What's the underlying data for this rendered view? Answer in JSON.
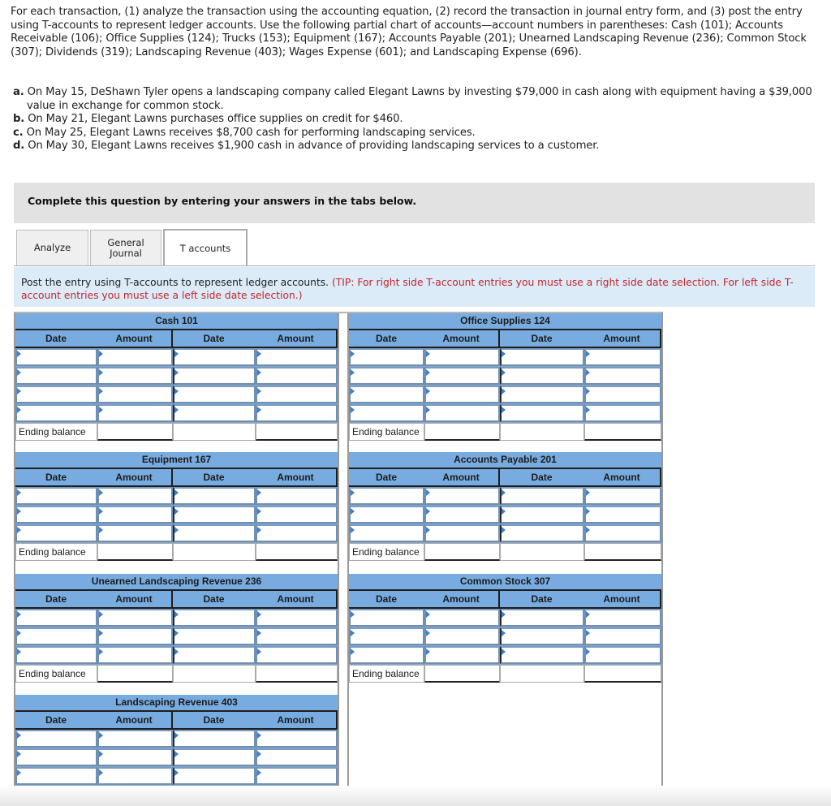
{
  "intro": {
    "text": "For each transaction, (1) analyze the transaction using the accounting equation, (2) record the transaction in journal entry form, and (3) post the entry using T-accounts to represent ledger accounts. Use the following partial chart of accounts—account numbers in parentheses: Cash (101); Accounts Receivable (106); Office Supplies (124); Trucks (153); Equipment (167); Accounts Payable (201); Unearned Landscaping Revenue (236); Common Stock (307); Dividends (319); Landscaping Revenue (403); Wages Expense (601); and Landscaping Expense (696)."
  },
  "transactions": [
    {
      "letter": "a.",
      "text": "On May 15, DeShawn Tyler opens a landscaping company called Elegant Lawns by investing $79,000 in cash along with equipment having a $39,000 value in exchange for common stock."
    },
    {
      "letter": "b.",
      "text": "On May 21, Elegant Lawns purchases office supplies on credit for $460."
    },
    {
      "letter": "c.",
      "text": "On May 25, Elegant Lawns receives $8,700 cash for performing landscaping services."
    },
    {
      "letter": "d.",
      "text": "On May 30, Elegant Lawns receives $1,900 cash in advance of providing landscaping services to a customer."
    }
  ],
  "banner": "Complete this question by entering your answers in the tabs below.",
  "tabs": [
    {
      "label_line1": "Analyze",
      "label_line2": "",
      "active": false
    },
    {
      "label_line1": "General",
      "label_line2": "Journal",
      "active": false
    },
    {
      "label_line1": "T accounts",
      "label_line2": "",
      "active": true
    }
  ],
  "instruction": {
    "text": "Post the entry using T-accounts to represent ledger accounts. ",
    "tip": "(TIP: For right side T-account entries you must use a right side date selection. For left side T-account entries you must use a left side date selection.)"
  },
  "column_headers": {
    "date": "Date",
    "amount": "Amount"
  },
  "ending_balance_label": "Ending balance",
  "accounts": [
    {
      "title": "Cash 101",
      "rows": 4,
      "side": "left"
    },
    {
      "title": "Office Supplies 124",
      "rows": 4,
      "side": "right"
    },
    {
      "title": "Equipment 167",
      "rows": 3,
      "side": "left"
    },
    {
      "title": "Accounts Payable 201",
      "rows": 3,
      "side": "right"
    },
    {
      "title": "Unearned Landscaping Revenue 236",
      "rows": 3,
      "side": "left"
    },
    {
      "title": "Common Stock 307",
      "rows": 3,
      "side": "right"
    },
    {
      "title": "Landscaping Revenue 403",
      "rows": 3,
      "side": "left"
    }
  ],
  "colors": {
    "header_blue": "#78ace0",
    "instruction_bg": "#dcebf8",
    "tip_red": "#c0272d",
    "banner_gray": "#e2e2e2"
  }
}
